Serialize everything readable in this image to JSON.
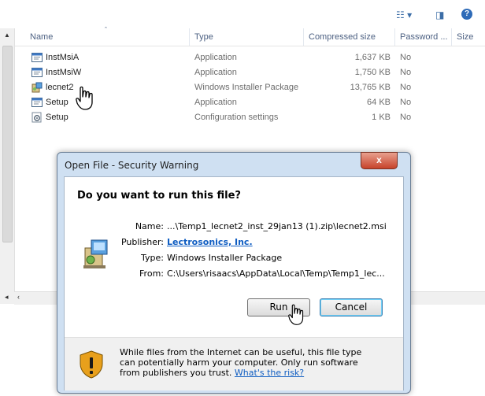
{
  "explorer": {
    "columns": {
      "name": "Name",
      "type": "Type",
      "compressed_size": "Compressed size",
      "password": "Password ...",
      "size": "Size"
    },
    "files": [
      {
        "name": "InstMsiA",
        "type": "Application",
        "compressed_size": "1,637 KB",
        "password": "No",
        "icon": "application-icon"
      },
      {
        "name": "InstMsiW",
        "type": "Application",
        "compressed_size": "1,750 KB",
        "password": "No",
        "icon": "application-icon"
      },
      {
        "name": "lecnet2",
        "type": "Windows Installer Package",
        "compressed_size": "13,765 KB",
        "password": "No",
        "icon": "installer-package-icon"
      },
      {
        "name": "Setup",
        "type": "Application",
        "compressed_size": "64 KB",
        "password": "No",
        "icon": "application-icon"
      },
      {
        "name": "Setup",
        "type": "Configuration settings",
        "compressed_size": "1 KB",
        "password": "No",
        "icon": "config-settings-icon"
      }
    ]
  },
  "dialog": {
    "title": "Open File - Security Warning",
    "close_label": "x",
    "question": "Do you want to run this file?",
    "fields": {
      "name_label": "Name:",
      "name_value": "...\\Temp1_lecnet2_inst_29jan13 (1).zip\\lecnet2.msi",
      "publisher_label": "Publisher:",
      "publisher_value": "Lectrosonics, Inc.",
      "type_label": "Type:",
      "type_value": "Windows Installer Package",
      "from_label": "From:",
      "from_value": "C:\\Users\\risaacs\\AppData\\Local\\Temp\\Temp1_lec..."
    },
    "run_label": "Run",
    "cancel_label": "Cancel",
    "warning_text": "While files from the Internet can be useful, this file type can potentially harm your computer. Only run software from publishers you trust.",
    "warning_link": "What's the risk?"
  },
  "colors": {
    "link": "#0f5dc2",
    "close_button": "#c7432b",
    "dialog_frame": "#cfe0f2",
    "header_text": "#4c6082"
  }
}
